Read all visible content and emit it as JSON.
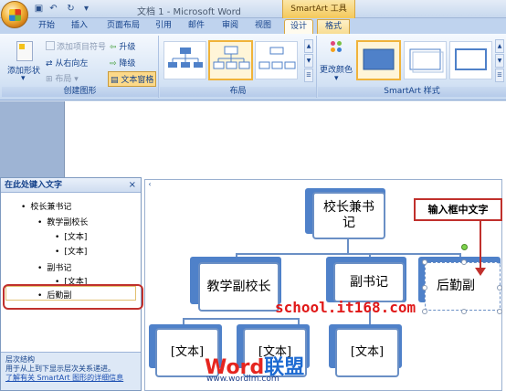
{
  "window": {
    "title": "文档 1 - Microsoft Word",
    "context_tool": "SmartArt 工具"
  },
  "tabs": [
    "开始",
    "插入",
    "页面布局",
    "引用",
    "邮件",
    "审阅",
    "视图",
    "设计",
    "格式"
  ],
  "ribbon": {
    "create_group": {
      "label": "创建图形",
      "add_shape": "添加形状",
      "add_bullet": "添加项目符号",
      "right_to_left": "从右向左",
      "layout": "布局",
      "promote": "升级",
      "demote": "降级",
      "text_pane": "文本窗格"
    },
    "layout_group": {
      "label": "布局"
    },
    "style_group": {
      "label": "SmartArt 样式",
      "change_colors": "更改颜色"
    }
  },
  "text_pane": {
    "title": "在此处键入文字",
    "items": [
      {
        "text": "校长兼书记",
        "level": 1
      },
      {
        "text": "教学副校长",
        "level": 2
      },
      {
        "text": "[文本]",
        "level": 3
      },
      {
        "text": "[文本]",
        "level": 3
      },
      {
        "text": "副书记",
        "level": 2
      },
      {
        "text": "[文本]",
        "level": 3
      },
      {
        "text": "后勤副",
        "level": 2
      }
    ],
    "footer_title": "层次结构",
    "footer_desc": "用于从上到下显示层次关系递进。",
    "footer_link": "了解有关 SmartArt 图形的详细信息"
  },
  "diagram": {
    "top": "校长兼书记",
    "mid": [
      "教学副校长",
      "副书记",
      "后勤副"
    ],
    "bottom": [
      "[文本]",
      "[文本]",
      "[文本]"
    ]
  },
  "callout": "输入框中文字",
  "watermark": {
    "site": "school.it168.com",
    "logo_a": "Word",
    "logo_b": "联盟",
    "url": "www.wordlm.com"
  },
  "colors": {
    "accent": "#4f81c9",
    "highlight": "#c0302c",
    "context_tab": "#f4c95a"
  }
}
